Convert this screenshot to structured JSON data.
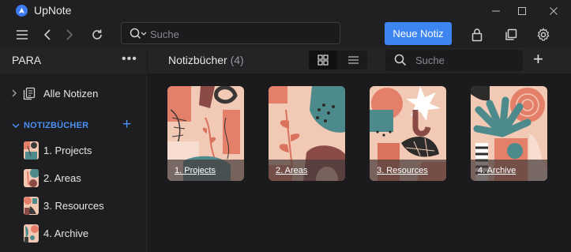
{
  "app": {
    "title": "UpNote"
  },
  "toolbar": {
    "search_placeholder": "Suche",
    "new_note_label": "Neue Notiz"
  },
  "sidebar": {
    "title": "PARA",
    "more": "•••",
    "all_notes_label": "Alle Notizen",
    "section_title": "NOTIZBÜCHER",
    "section_add": "+",
    "notebooks": [
      {
        "label": "1. Projects"
      },
      {
        "label": "2. Areas"
      },
      {
        "label": "3. Resources"
      },
      {
        "label": "4. Archive"
      }
    ]
  },
  "main": {
    "title": "Notizbücher",
    "count": "(4)",
    "search_placeholder": "Suche",
    "add": "+",
    "cards": [
      {
        "label": "1. Projects"
      },
      {
        "label": "2. Areas"
      },
      {
        "label": "3. Resources"
      },
      {
        "label": "4. Archive"
      }
    ]
  },
  "colors": {
    "accent": "#3d86f2",
    "section_accent": "#4c8ff5",
    "background": "#1b1b1d",
    "cover_peach": "#f3cbb6",
    "cover_teal": "#4d8a8c",
    "cover_coral": "#e4806a",
    "cover_maroon": "#8a4a45"
  },
  "icons": {
    "menu": "hamburger-icon",
    "back": "chevron-left-icon",
    "forward": "chevron-right-icon",
    "refresh": "refresh-icon",
    "search": "search-icon",
    "lock": "lock-icon",
    "copy": "copy-icon",
    "settings": "gear-icon",
    "grid": "grid-icon",
    "list": "list-icon"
  }
}
